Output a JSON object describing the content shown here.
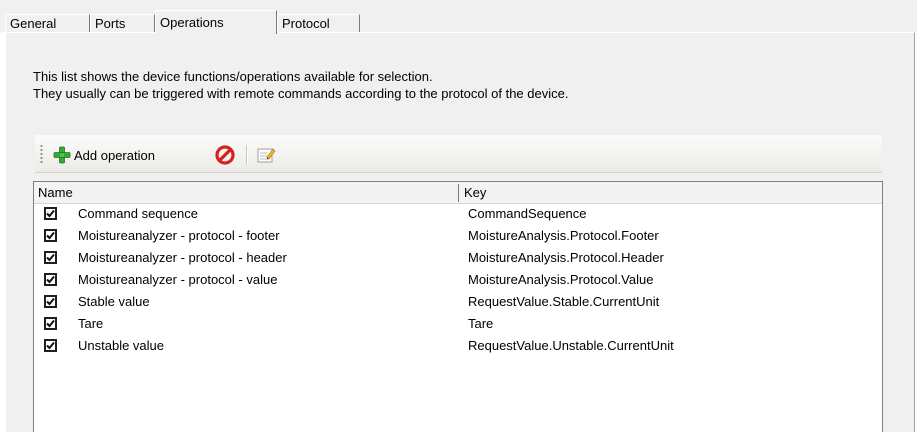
{
  "tabs": [
    {
      "label": "General",
      "active": false
    },
    {
      "label": "Ports",
      "active": false
    },
    {
      "label": "Operations",
      "active": true
    },
    {
      "label": "Protocol",
      "active": false
    }
  ],
  "description": {
    "line1": "This list shows the device functions/operations available for selection.",
    "line2": "They usually can be triggered with remote commands according to the protocol of the device."
  },
  "toolbar": {
    "add_label": "Add operation",
    "icons": [
      "add-green-plus-icon",
      "delete-red-circle-icon",
      "edit-note-icon"
    ]
  },
  "list": {
    "headers": {
      "name": "Name",
      "key": "Key"
    },
    "rows": [
      {
        "checked": true,
        "name": "Command sequence",
        "key": "CommandSequence"
      },
      {
        "checked": true,
        "name": "Moistureanalyzer - protocol - footer",
        "key": "MoistureAnalysis.Protocol.Footer"
      },
      {
        "checked": true,
        "name": "Moistureanalyzer - protocol - header",
        "key": "MoistureAnalysis.Protocol.Header"
      },
      {
        "checked": true,
        "name": "Moistureanalyzer - protocol - value",
        "key": "MoistureAnalysis.Protocol.Value"
      },
      {
        "checked": true,
        "name": "Stable value",
        "key": "RequestValue.Stable.CurrentUnit"
      },
      {
        "checked": true,
        "name": "Tare",
        "key": "Tare"
      },
      {
        "checked": true,
        "name": "Unstable value",
        "key": "RequestValue.Unstable.CurrentUnit"
      }
    ]
  },
  "colors": {
    "window_bg": "#f0f0f0",
    "add_green": "#3aa63a",
    "delete_red": "#d62020"
  }
}
